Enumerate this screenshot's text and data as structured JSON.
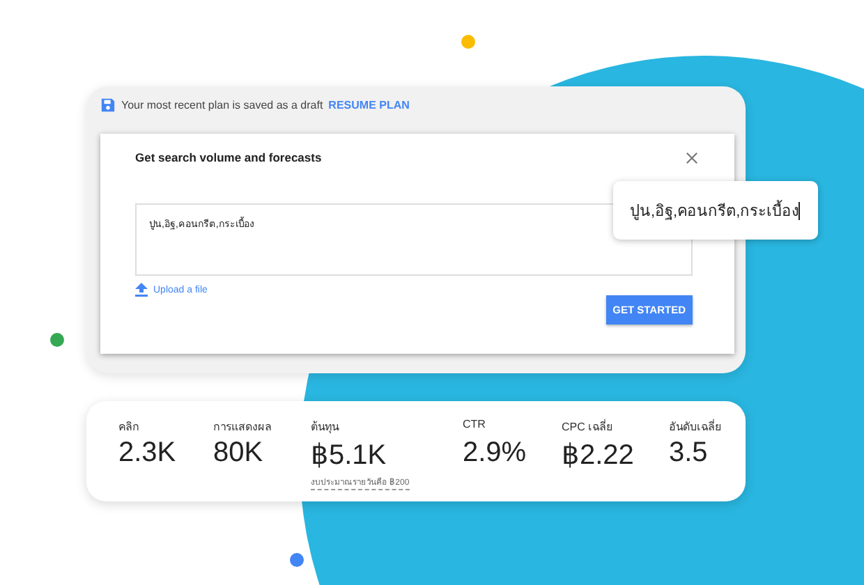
{
  "draft_banner": {
    "text": "Your most recent plan is saved as a draft",
    "link": "RESUME PLAN"
  },
  "dialog": {
    "title": "Get search volume and forecasts",
    "keywords_value": "ปูน,อิฐ,คอนกรีต,กระเบื้อง",
    "upload_link": "Upload a file",
    "button": "GET STARTED"
  },
  "callout": {
    "text": "ปูน,อิฐ,คอนกรีต,กระเบื้อง"
  },
  "metrics": [
    {
      "label": "คลิก",
      "value": "2.3K"
    },
    {
      "label": "การแสดงผล",
      "value": "80K"
    },
    {
      "label": "ต้นทุน",
      "value": "฿5.1K",
      "note": "งบประมาณรายวันคือ ฿200"
    },
    {
      "label": "CTR",
      "value": "2.9%"
    },
    {
      "label": "CPC เฉลี่ย",
      "value": "฿2.22"
    },
    {
      "label": "อันดับเฉลี่ย",
      "value": "3.5"
    }
  ]
}
